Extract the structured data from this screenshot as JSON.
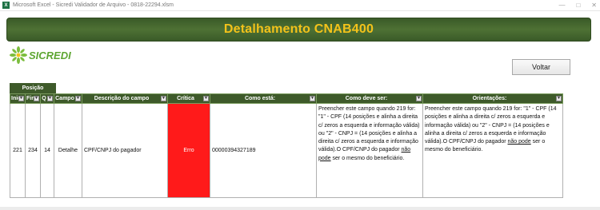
{
  "window": {
    "title": "Microsoft Excel - Sicredi Validador de Arquivo - 0818-22294.xlsm",
    "app_icon": "excel-icon"
  },
  "banner": {
    "title": "Detalhamento CNAB400"
  },
  "logo": {
    "text": "SICREDI",
    "icon": "sicredi-logo-icon",
    "color": "#5ea632"
  },
  "voltar_label": "Voltar",
  "colors": {
    "header_green": "#3e5a2a",
    "banner_text": "#f3c21a",
    "error_red": "#ff1a1a"
  },
  "table": {
    "group_header": "Posição",
    "headers": [
      "Inic",
      "Fim",
      "Q",
      "Campo",
      "Descrição do campo",
      "Crítica",
      "Como está:",
      "Como deve ser:",
      "Orientações:"
    ],
    "rows": [
      {
        "inic": "221",
        "fim": "234",
        "q": "14",
        "campo": "Detalhe",
        "descricao": "CPF/CNPJ do pagador",
        "critica": "Erro",
        "como_esta": "00000394327189",
        "como_deve_ser_a": "Preencher este campo quando 219 for: \"1\" - CPF (14 posições e alinha a direita c/ zeros a esquerda e informação válida) ou \"2\" - CNPJ = (14 posições e alinha a direita c/ zeros a esquerda e informação válida).O CPF/CNPJ do pagador ",
        "como_deve_ser_u": "não pode",
        "como_deve_ser_b": " ser o mesmo do beneficiário.",
        "orientacoes_a": "Preencher este campo quando 219 for: \"1\" - CPF (14 posições e alinha a direita c/ zeros a esquerda e informação válida) ou \"2\" - CNPJ = (14 posições e alinha a direita c/ zeros a esquerda e informação válida).O CPF/CNPJ do pagador ",
        "orientacoes_u": "não pode",
        "orientacoes_b": " ser o mesmo do beneficiário."
      }
    ]
  }
}
